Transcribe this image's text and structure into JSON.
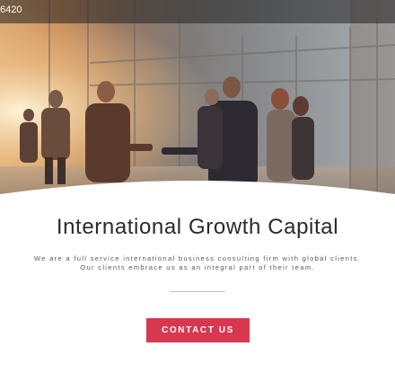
{
  "header": {
    "phone": "6420"
  },
  "hero": {
    "image": "business-handshake-photo"
  },
  "main": {
    "title": "International Growth Capital",
    "description_line1": "We are a full service international business consulting firm with global clients.",
    "description_line2": "Our clients embrace us as an integral part of their team.",
    "cta_label": "CONTACT US"
  },
  "colors": {
    "accent": "#d8384f",
    "title": "#2a2a2a",
    "text": "#5a5a5a",
    "divider": "#bfbfbf",
    "topbar": "#232323"
  }
}
